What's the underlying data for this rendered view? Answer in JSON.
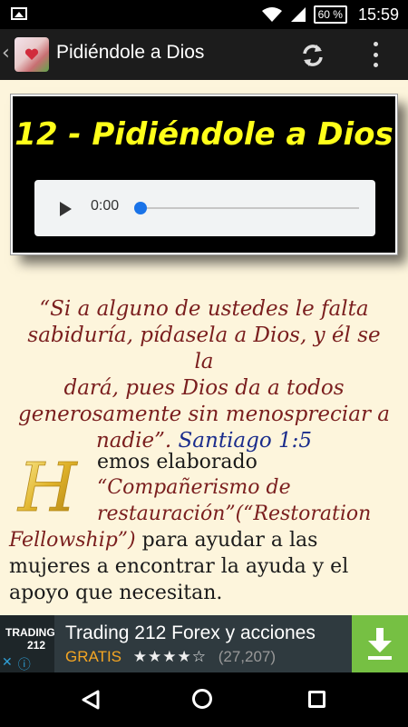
{
  "status_bar": {
    "battery": "60 %",
    "time": "15:59",
    "icons": [
      "image-notification-icon",
      "wifi-icon",
      "signal-icon",
      "battery-icon"
    ]
  },
  "action_bar": {
    "title": "Pidiéndole a Dios",
    "icons": [
      "app-icon",
      "refresh-icon",
      "overflow-menu-icon"
    ]
  },
  "lesson": {
    "title": "12 - Pidiéndole a Dios",
    "audio": {
      "time": "0:00",
      "progress": 0
    }
  },
  "quote": {
    "lines": [
      "“Si a alguno de ustedes le falta",
      "sabiduría, pídasela a Dios, y él se la",
      "dará, pues Dios da a todos",
      "generosamente sin menospreciar a",
      "nadie”."
    ],
    "reference": "Santiago 1:5"
  },
  "paragraph": {
    "drop_cap": "H",
    "lines": [
      {
        "text": "emos elaborado",
        "italic": false
      },
      {
        "text": "“Compañerismo de",
        "italic": true
      },
      {
        "text": "restauración”(“Restoration",
        "italic": true
      },
      {
        "text": "Fellowship”)",
        "italic": true
      },
      {
        "text": " para ayudar a las",
        "italic": false
      },
      {
        "text": "mujeres a encontrar la ayuda y el",
        "italic": false
      },
      {
        "text": "apoyo que necesitan.",
        "italic": false
      }
    ]
  },
  "ad": {
    "logo_line1": "TRADING",
    "logo_line2": "212",
    "title": "Trading 212 Forex y acciones",
    "price": "GRATIS",
    "stars": "★★★★☆",
    "rating": 4.5,
    "reviews": "(27,207)"
  },
  "colors": {
    "title_yellow": "#ffff1a",
    "quote_red": "#7a1e1e",
    "reference_blue": "#1a2c8c",
    "page_bg": "#fdf5dc",
    "ad_green": "#76c043",
    "player_blue": "#1a73e8"
  }
}
